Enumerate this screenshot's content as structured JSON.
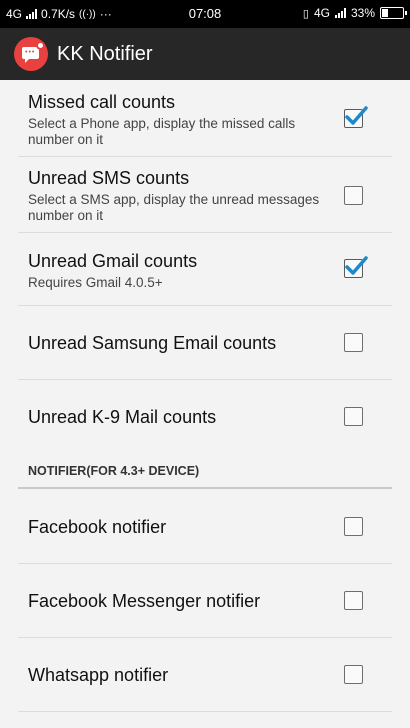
{
  "status_bar": {
    "network": "4G",
    "speed": "0.7K/s",
    "more": "···",
    "time": "07:08",
    "network_right": "4G",
    "battery": "33%"
  },
  "app_bar": {
    "icon": "notifier-bubble-icon",
    "title": "KK Notifier",
    "brand_color": "#e8413f"
  },
  "settings": {
    "items": [
      {
        "title": "Missed call counts",
        "summary": "Select a Phone app, display the missed calls number on it",
        "checked": true
      },
      {
        "title": "Unread SMS counts",
        "summary": "Select a SMS app, display the unread messages number on it",
        "checked": false
      },
      {
        "title": "Unread Gmail counts",
        "summary": "Requires Gmail 4.0.5+",
        "checked": true
      },
      {
        "title": "Unread Samsung Email counts",
        "summary": "",
        "checked": false
      },
      {
        "title": "Unread K-9 Mail counts",
        "summary": "",
        "checked": false
      }
    ],
    "notifier_section": {
      "header": "NOTIFIER(FOR 4.3+ DEVICE)",
      "items": [
        {
          "title": "Facebook notifier",
          "checked": false
        },
        {
          "title": "Facebook Messenger notifier",
          "checked": false
        },
        {
          "title": "Whatsapp notifier",
          "checked": false
        }
      ]
    },
    "check_color": "#1e88c8"
  }
}
